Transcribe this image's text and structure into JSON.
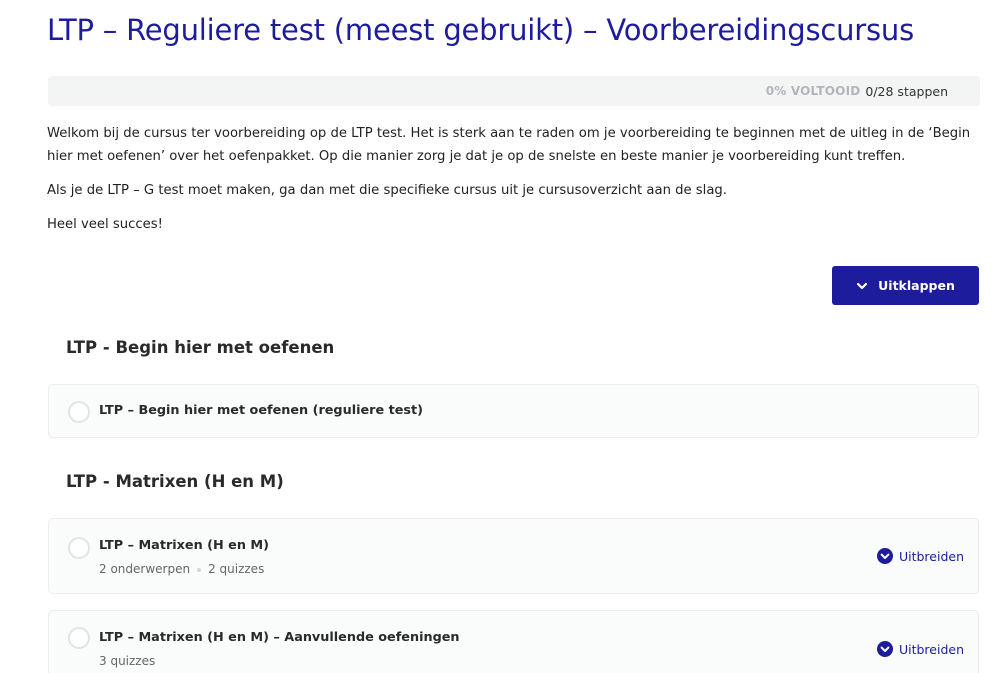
{
  "page": {
    "title": "LTP – Reguliere test (meest gebruikt) – Voorbereidingscursus"
  },
  "progress": {
    "percent_label": "0% VOLTOOID",
    "steps_label": "0/28 stappen",
    "fraction": 0
  },
  "intro": {
    "paragraph_1": "Welkom bij de cursus ter voorbereiding op de LTP test. Het is sterk aan te raden om je voorbereiding te beginnen met de uitleg in de ‘Begin hier met oefenen’ over het oefenpakket. Op die manier zorg je dat je op de snelste en beste manier je voorbereiding kunt treffen.",
    "paragraph_2": "Als je de LTP – G test moet maken, ga dan met die specifieke cursus uit je cursusoverzicht aan de slag.",
    "paragraph_3": "Heel veel succes!"
  },
  "expand_all": {
    "label": "Uitklappen",
    "icon": "chevron-down-icon"
  },
  "sections": [
    {
      "heading": "LTP - Begin hier met oefenen",
      "lessons": [
        {
          "title": "LTP – Begin hier met oefenen (reguliere test)"
        }
      ]
    },
    {
      "heading": "LTP - Matrixen (H en M)",
      "lessons": [
        {
          "title": "LTP – Matrixen (H en M)",
          "meta_1": "2 onderwerpen",
          "meta_2": "2 quizzes",
          "expand_label": "Uitbreiden"
        },
        {
          "title": "LTP – Matrixen (H en M) – Aanvullende oefeningen",
          "meta_1": "3 quizzes",
          "expand_label": "Uitbreiden"
        }
      ]
    }
  ],
  "colors": {
    "accent": "#1c1c9c",
    "card_bg": "#fafbfb",
    "muted": "#b2b6bb"
  }
}
